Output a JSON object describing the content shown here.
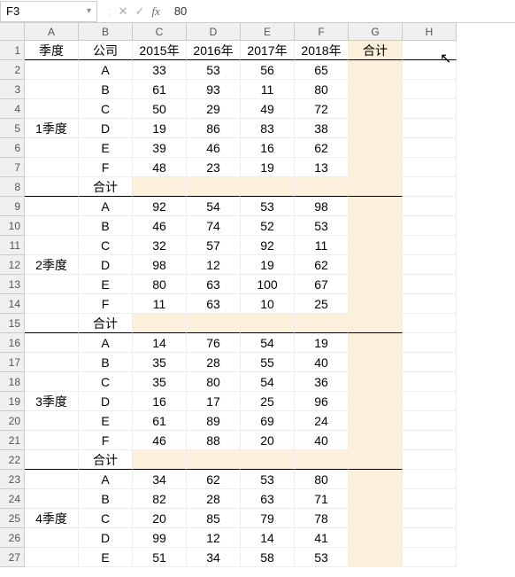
{
  "name_box": "F3",
  "formula_value": "80",
  "icons": {
    "dropdown": "▾",
    "cancel": "✕",
    "confirm": "✓",
    "fx": "fx",
    "sep": ":"
  },
  "columns": [
    "A",
    "B",
    "C",
    "D",
    "E",
    "F",
    "G",
    "H"
  ],
  "rows_count": 27,
  "headers": {
    "quarter": "季度",
    "company": "公司",
    "y2015": "2015年",
    "y2016": "2016年",
    "y2017": "2017年",
    "y2018": "2018年",
    "total": "合计"
  },
  "subtotal_label": "合计",
  "quarters": [
    {
      "name": "1季度",
      "rows": [
        {
          "co": "A",
          "v": [
            33,
            53,
            56,
            65
          ]
        },
        {
          "co": "B",
          "v": [
            61,
            93,
            11,
            80
          ]
        },
        {
          "co": "C",
          "v": [
            50,
            29,
            49,
            72
          ]
        },
        {
          "co": "D",
          "v": [
            19,
            86,
            83,
            38
          ]
        },
        {
          "co": "E",
          "v": [
            39,
            46,
            16,
            62
          ]
        },
        {
          "co": "F",
          "v": [
            48,
            23,
            19,
            13
          ]
        }
      ]
    },
    {
      "name": "2季度",
      "rows": [
        {
          "co": "A",
          "v": [
            92,
            54,
            53,
            98
          ]
        },
        {
          "co": "B",
          "v": [
            46,
            74,
            52,
            53
          ]
        },
        {
          "co": "C",
          "v": [
            32,
            57,
            92,
            11
          ]
        },
        {
          "co": "D",
          "v": [
            98,
            12,
            19,
            62
          ]
        },
        {
          "co": "E",
          "v": [
            80,
            63,
            100,
            67
          ]
        },
        {
          "co": "F",
          "v": [
            11,
            63,
            10,
            25
          ]
        }
      ]
    },
    {
      "name": "3季度",
      "rows": [
        {
          "co": "A",
          "v": [
            14,
            76,
            54,
            19
          ]
        },
        {
          "co": "B",
          "v": [
            35,
            28,
            55,
            40
          ]
        },
        {
          "co": "C",
          "v": [
            35,
            80,
            54,
            36
          ]
        },
        {
          "co": "D",
          "v": [
            16,
            17,
            25,
            96
          ]
        },
        {
          "co": "E",
          "v": [
            61,
            89,
            69,
            24
          ]
        },
        {
          "co": "F",
          "v": [
            46,
            88,
            20,
            40
          ]
        }
      ]
    },
    {
      "name": "4季度",
      "rows": [
        {
          "co": "A",
          "v": [
            34,
            62,
            53,
            80
          ]
        },
        {
          "co": "B",
          "v": [
            82,
            28,
            63,
            71
          ]
        },
        {
          "co": "C",
          "v": [
            20,
            85,
            79,
            78
          ]
        },
        {
          "co": "D",
          "v": [
            99,
            12,
            14,
            41
          ]
        },
        {
          "co": "E",
          "v": [
            51,
            34,
            58,
            53
          ]
        }
      ]
    }
  ],
  "chart_data": {
    "type": "table",
    "title": "Quarterly company values 2015-2018",
    "columns": [
      "季度",
      "公司",
      "2015年",
      "2016年",
      "2017年",
      "2018年",
      "合计"
    ],
    "data": [
      [
        "1季度",
        "A",
        33,
        53,
        56,
        65
      ],
      [
        "1季度",
        "B",
        61,
        93,
        11,
        80
      ],
      [
        "1季度",
        "C",
        50,
        29,
        49,
        72
      ],
      [
        "1季度",
        "D",
        19,
        86,
        83,
        38
      ],
      [
        "1季度",
        "E",
        39,
        46,
        16,
        62
      ],
      [
        "1季度",
        "F",
        48,
        23,
        19,
        13
      ],
      [
        "2季度",
        "A",
        92,
        54,
        53,
        98
      ],
      [
        "2季度",
        "B",
        46,
        74,
        52,
        53
      ],
      [
        "2季度",
        "C",
        32,
        57,
        92,
        11
      ],
      [
        "2季度",
        "D",
        98,
        12,
        19,
        62
      ],
      [
        "2季度",
        "E",
        80,
        63,
        100,
        67
      ],
      [
        "2季度",
        "F",
        11,
        63,
        10,
        25
      ],
      [
        "3季度",
        "A",
        14,
        76,
        54,
        19
      ],
      [
        "3季度",
        "B",
        35,
        28,
        55,
        40
      ],
      [
        "3季度",
        "C",
        35,
        80,
        54,
        36
      ],
      [
        "3季度",
        "D",
        16,
        17,
        25,
        96
      ],
      [
        "3季度",
        "E",
        61,
        89,
        69,
        24
      ],
      [
        "3季度",
        "F",
        46,
        88,
        20,
        40
      ],
      [
        "4季度",
        "A",
        34,
        62,
        53,
        80
      ],
      [
        "4季度",
        "B",
        82,
        28,
        63,
        71
      ],
      [
        "4季度",
        "C",
        20,
        85,
        79,
        78
      ],
      [
        "4季度",
        "D",
        99,
        12,
        14,
        41
      ],
      [
        "4季度",
        "E",
        51,
        34,
        58,
        53
      ]
    ]
  }
}
